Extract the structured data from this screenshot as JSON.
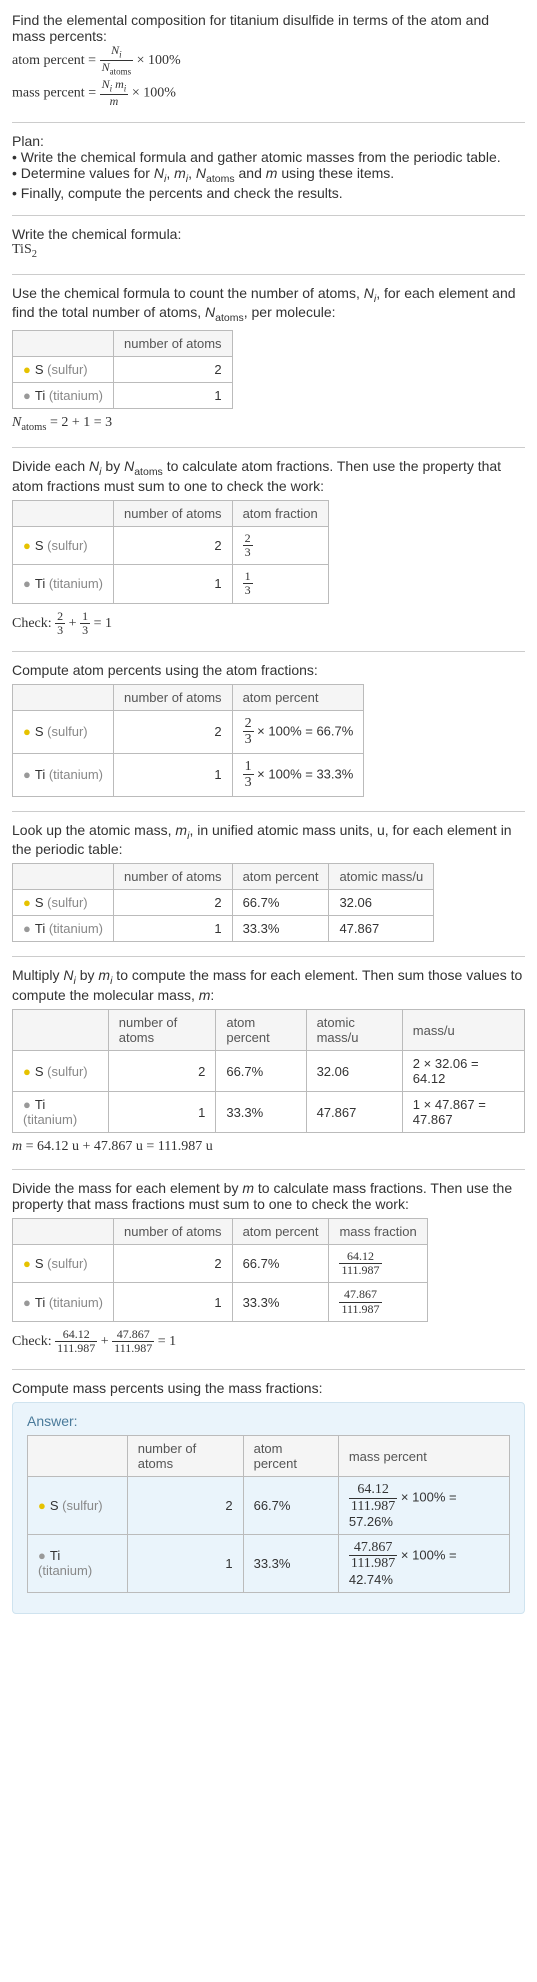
{
  "intro": {
    "p1": "Find the elemental composition for titanium disulfide in terms of the atom and mass percents:",
    "atom_percent_lhs": "atom percent = ",
    "atom_percent_times": " × 100%",
    "mass_percent_lhs": "mass percent = ",
    "mass_percent_times": " × 100%",
    "ap_num": "N_i",
    "ap_den": "N_atoms",
    "mp_num": "N_i m_i",
    "mp_den": "m"
  },
  "plan": {
    "title": "Plan:",
    "b1": "• Write the chemical formula and gather atomic masses from the periodic table.",
    "b2_pre": "• Determine values for ",
    "b2_vars": "N_i, m_i, N_atoms",
    "b2_mid": " and ",
    "b2_m": "m",
    "b2_post": " using these items.",
    "b3": "• Finally, compute the percents and check the results."
  },
  "formula_section": {
    "label": "Write the chemical formula:",
    "formula": "TiS",
    "sub": "2"
  },
  "count_section": {
    "p_pre": "Use the chemical formula to count the number of atoms, ",
    "ni": "N_i",
    "p_mid": ", for each element and find the total number of atoms, ",
    "natoms": "N_atoms",
    "p_post": ", per molecule:",
    "h_atoms": "number of atoms",
    "s_label": "S ",
    "s_paren": "(sulfur)",
    "s_n": "2",
    "ti_label": "Ti ",
    "ti_paren": "(titanium)",
    "ti_n": "1",
    "eq": "N_atoms = 2 + 1 = 3"
  },
  "atomfrac_section": {
    "p_pre": "Divide each ",
    "ni": "N_i",
    "p_mid": " by ",
    "natoms": "N_atoms",
    "p_post": " to calculate atom fractions. Then use the property that atom fractions must sum to one to check the work:",
    "h_atoms": "number of atoms",
    "h_frac": "atom fraction",
    "s_n": "2",
    "s_num": "2",
    "s_den": "3",
    "ti_n": "1",
    "ti_num": "1",
    "ti_den": "3",
    "check_pre": "Check: ",
    "check_eq": " = 1"
  },
  "atompct_section": {
    "p": "Compute atom percents using the atom fractions:",
    "h_atoms": "number of atoms",
    "h_pct": "atom percent",
    "s_n": "2",
    "s_num": "2",
    "s_den": "3",
    "s_res": " × 100% = 66.7%",
    "ti_n": "1",
    "ti_num": "1",
    "ti_den": "3",
    "ti_res": " × 100% = 33.3%"
  },
  "mass_section": {
    "p_pre": "Look up the atomic mass, ",
    "mi": "m_i",
    "p_post": ", in unified atomic mass units, u, for each element in the periodic table:",
    "h_atoms": "number of atoms",
    "h_pct": "atom percent",
    "h_mass": "atomic mass/u",
    "s_n": "2",
    "s_pct": "66.7%",
    "s_mass": "32.06",
    "ti_n": "1",
    "ti_pct": "33.3%",
    "ti_mass": "47.867"
  },
  "molmass_section": {
    "p_pre": "Multiply ",
    "ni": "N_i",
    "p_mid": " by ",
    "mi": "m_i",
    "p_post": " to compute the mass for each element. Then sum those values to compute the molecular mass, ",
    "m": "m",
    "p_end": ":",
    "h_atoms": "number of atoms",
    "h_pct": "atom percent",
    "h_amass": "atomic mass/u",
    "h_mass": "mass/u",
    "s_n": "2",
    "s_pct": "66.7%",
    "s_amass": "32.06",
    "s_mass": "2 × 32.06 = 64.12",
    "ti_n": "1",
    "ti_pct": "33.3%",
    "ti_amass": "47.867",
    "ti_mass": "1 × 47.867 = 47.867",
    "eq": "m = 64.12 u + 47.867 u = 111.987 u"
  },
  "massfrac_section": {
    "p_pre": "Divide the mass for each element by ",
    "m": "m",
    "p_post": " to calculate mass fractions. Then use the property that mass fractions must sum to one to check the work:",
    "h_atoms": "number of atoms",
    "h_pct": "atom percent",
    "h_mf": "mass fraction",
    "s_n": "2",
    "s_pct": "66.7%",
    "s_num": "64.12",
    "s_den": "111.987",
    "ti_n": "1",
    "ti_pct": "33.3%",
    "ti_num": "47.867",
    "ti_den": "111.987",
    "check_pre": "Check: ",
    "check_eq": " = 1"
  },
  "masspct_section": {
    "p": "Compute mass percents using the mass fractions:"
  },
  "answer": {
    "label": "Answer:",
    "h_atoms": "number of atoms",
    "h_pct": "atom percent",
    "h_mass": "mass percent",
    "s_n": "2",
    "s_pct": "66.7%",
    "s_num": "64.12",
    "s_den": "111.987",
    "s_res": " × 100% = 57.26%",
    "ti_n": "1",
    "ti_pct": "33.3%",
    "ti_num": "47.867",
    "ti_den": "111.987",
    "ti_res": " × 100% = 42.74%"
  },
  "labels": {
    "s": "S ",
    "s_p": "(sulfur)",
    "ti": "Ti ",
    "ti_p": "(titanium)"
  }
}
